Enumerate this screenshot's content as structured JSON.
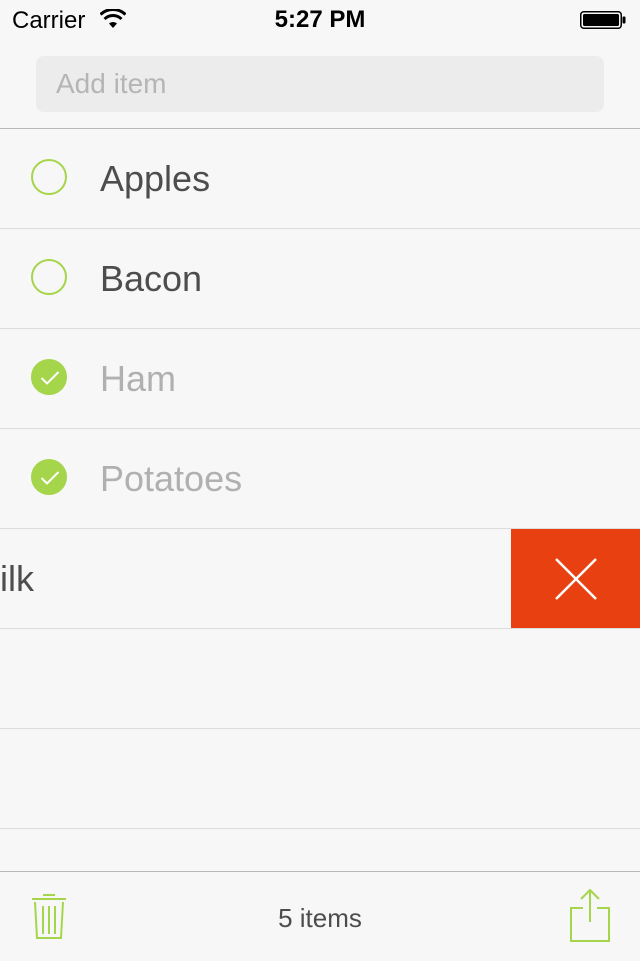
{
  "status": {
    "carrier": "Carrier",
    "time": "5:27 PM"
  },
  "add": {
    "placeholder": "Add item"
  },
  "items": [
    {
      "label": "Apples",
      "done": false
    },
    {
      "label": "Bacon",
      "done": false
    },
    {
      "label": "Ham",
      "done": true
    },
    {
      "label": "Potatoes",
      "done": true
    },
    {
      "label": "Milk",
      "done": false,
      "swiped": true
    }
  ],
  "footer": {
    "count": "5 items"
  },
  "icons": {
    "wifi": "wifi-icon",
    "battery": "battery-icon",
    "check": "checkmark-icon",
    "delete": "close-icon",
    "trash": "trash-icon",
    "share": "share-icon"
  },
  "colors": {
    "accent": "#a5d54a",
    "delete": "#e84010",
    "background": "#f7f7f7"
  }
}
